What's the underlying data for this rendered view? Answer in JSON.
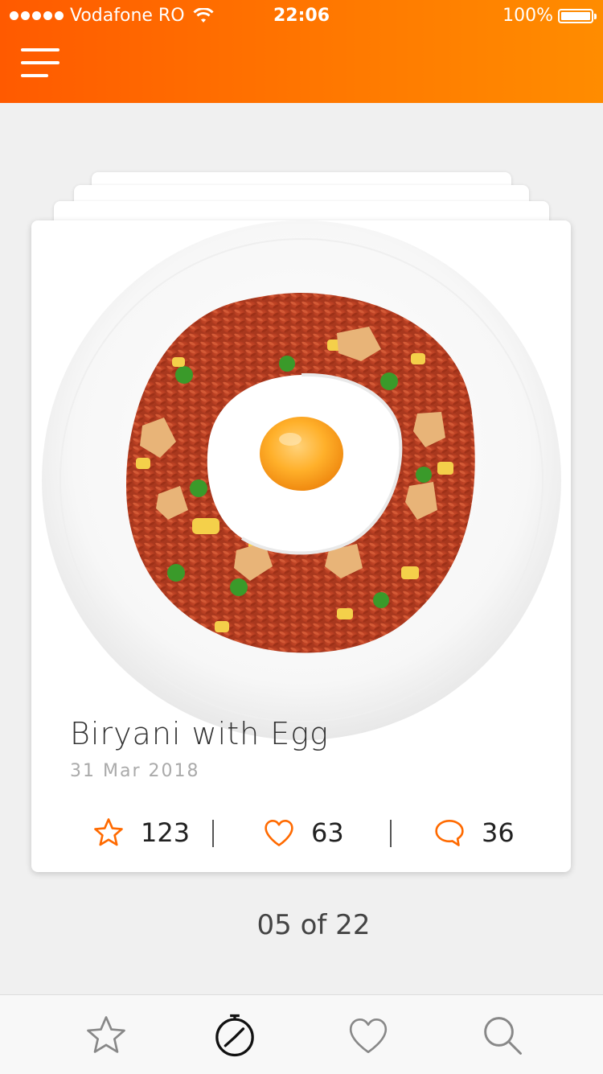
{
  "status_bar": {
    "carrier": "Vodafone RO",
    "time": "22:06",
    "battery": "100%",
    "battery_level": 1.0
  },
  "header": {
    "menu_icon": "hamburger-menu-icon"
  },
  "card": {
    "title": "Biryani with Egg",
    "date": "31 Mar 2018",
    "stats": {
      "favorites": "123",
      "likes": "63",
      "comments": "36"
    }
  },
  "pager": {
    "text": "05 of 22"
  },
  "tabbar": {
    "items": [
      {
        "icon": "star-icon",
        "active": false
      },
      {
        "icon": "timer-icon",
        "active": true
      },
      {
        "icon": "heart-icon",
        "active": false
      },
      {
        "icon": "search-icon",
        "active": false
      }
    ]
  },
  "colors": {
    "accent": "#ff6a00",
    "accent_light": "#ff8c00",
    "background": "#f0f0f0",
    "icon_inactive": "#888888",
    "icon_active": "#111111"
  }
}
